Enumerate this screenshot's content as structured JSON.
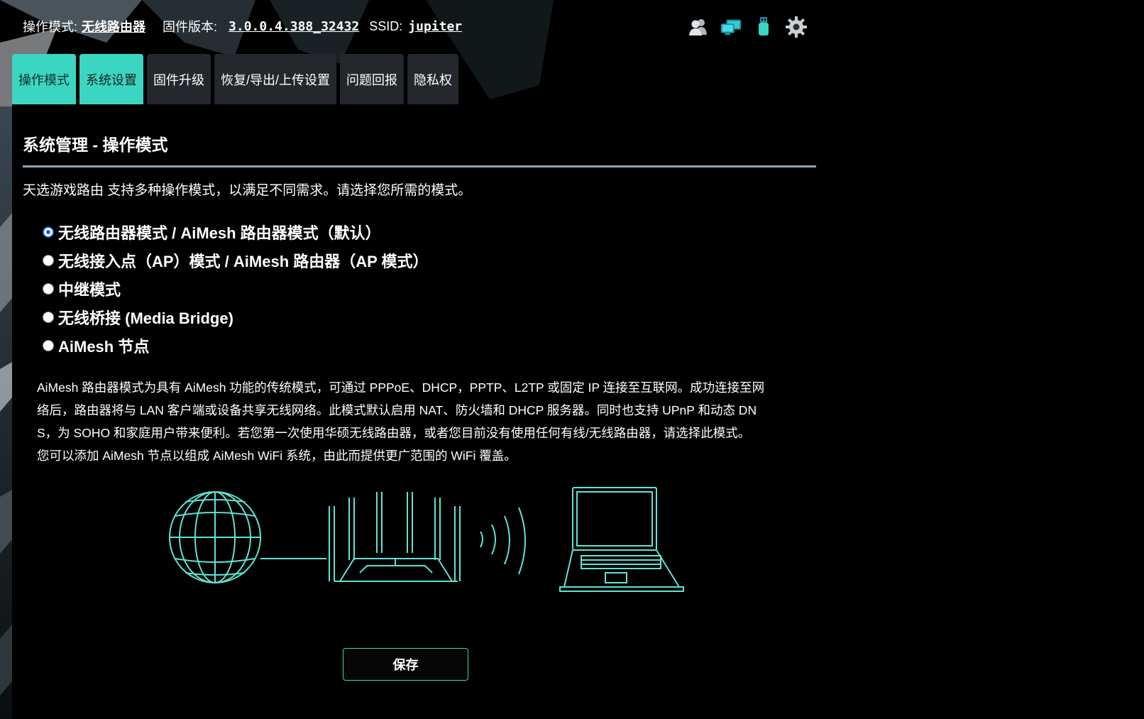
{
  "header": {
    "mode_label": "操作模式:",
    "mode_value": "无线路由器",
    "firmware_label": "固件版本:",
    "firmware_value": "3.0.0.4.388_32432",
    "ssid_label": "SSID:",
    "ssid_value": "jupiter",
    "icons": [
      "users-icon",
      "network-clients-icon",
      "usb-icon",
      "settings-gear-icon"
    ]
  },
  "tabs": [
    {
      "label": "操作模式",
      "state": "active"
    },
    {
      "label": "系统设置",
      "state": "selected"
    },
    {
      "label": "固件升级",
      "state": "normal"
    },
    {
      "label": "恢复/导出/上传设置",
      "state": "normal"
    },
    {
      "label": "问题回报",
      "state": "normal"
    },
    {
      "label": "隐私权",
      "state": "normal"
    }
  ],
  "main": {
    "title": "系统管理 - 操作模式",
    "intro": "天选游戏路由 支持多种操作模式，以满足不同需求。请选择您所需的模式。",
    "modes": [
      {
        "label": "无线路由器模式 / AiMesh 路由器模式（默认）",
        "checked": true
      },
      {
        "label": "无线接入点（AP）模式 / AiMesh 路由器（AP 模式）",
        "checked": false
      },
      {
        "label": "中继模式",
        "checked": false
      },
      {
        "label": "无线桥接 (Media Bridge)",
        "checked": false
      },
      {
        "label": "AiMesh 节点",
        "checked": false
      }
    ],
    "description_lines": [
      "AiMesh 路由器模式为具有 AiMesh 功能的传统模式，可通过 PPPoE、DHCP，PPTP、L2TP 或固定 IP 连接至互联网。成功连接至网",
      "络后，路由器将与 LAN 客户端或设备共享无线网络。此模式默认启用 NAT、防火墙和 DHCP 服务器。同时也支持 UPnP 和动态 DN",
      "S，为 SOHO 和家庭用户带来便利。若您第一次使用华硕无线路由器，或者您目前没有使用任何有线/无线路由器，请选择此模式。",
      "您可以添加 AiMesh 节点以组成 AiMesh WiFi 系统，由此而提供更广范围的 WiFi 覆盖。"
    ],
    "diagram_icons": [
      "globe-icon",
      "router-icon",
      "wifi-signal-icon",
      "laptop-icon"
    ],
    "save_label": "保存"
  },
  "colors": {
    "accent": "#3ad6c2",
    "tab_bg": "#24282c",
    "divider": "#8fa6b8",
    "radio_checked": "#1a64d6"
  }
}
